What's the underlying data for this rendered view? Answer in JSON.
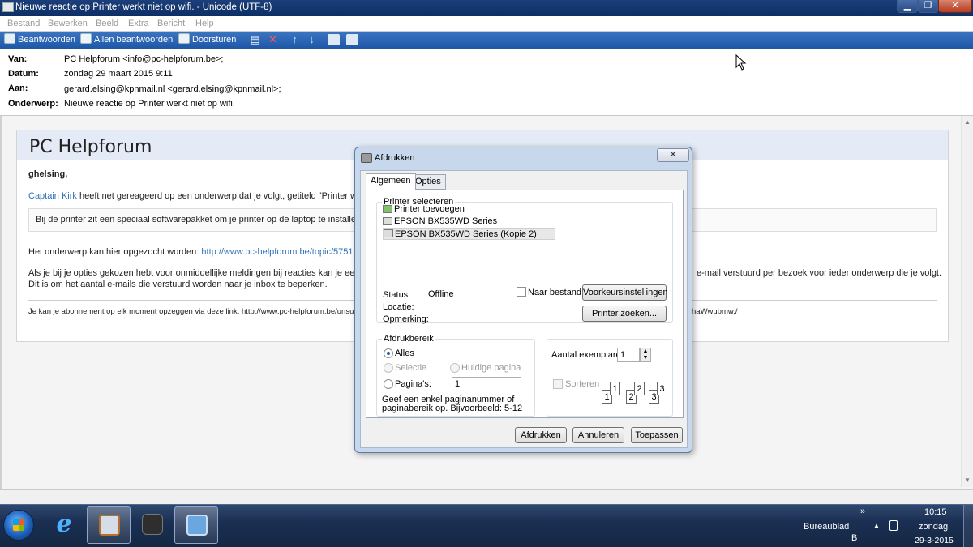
{
  "window": {
    "title": "Nieuwe reactie op Printer werkt niet op wifi. - Unicode (UTF-8)",
    "controls": {
      "minimize": "▁",
      "maximize": "❐",
      "close": "✕"
    }
  },
  "menu": [
    "Bestand",
    "Bewerken",
    "Beeld",
    "Extra",
    "Bericht",
    "Help"
  ],
  "toolbar": {
    "reply": "Beantwoorden",
    "reply_all": "Allen beantwoorden",
    "forward": "Doorsturen",
    "icons": [
      "print-icon",
      "delete-icon",
      "previous-icon",
      "next-icon",
      "addresses-icon",
      "contact-icon"
    ]
  },
  "headers": {
    "from_label": "Van:",
    "from": "PC Helpforum <info@pc-helpforum.be>;",
    "date_label": "Datum:",
    "date": "zondag 29 maart 2015 9:11",
    "to_label": "Aan:",
    "to": "gerard.elsing@kpnmail.nl <gerard.elsing@kpnmail.nl>;",
    "subject_label": "Onderwerp:",
    "subject": "Nieuwe reactie op Printer werkt niet op wifi."
  },
  "message": {
    "header_title": "PC Helpforum",
    "greeting": "ghelsing,",
    "author": "Captain Kirk",
    "line1": "heeft net gereageerd op een onderwerp dat je volgt, getiteld \"Printer werk",
    "quote": "Bij de printer zit een speciaal softwarepakket om je printer op de laptop te installere",
    "topic_text": "Het onderwerp kan hier opgezocht worden:",
    "topic_link": "http://www.pc-helpforum.be/topic/57513-p",
    "options_line1": "Als je bij je opties gekozen hebt voor onmiddellijke meldingen bij reacties kan je eeni",
    "options_line1_right": "e-mail verstuurd per bezoek voor ieder onderwerp die je volgt.",
    "options_line2": "Dit is om het aantal e-mails die verstuurd worden naar je inbox te beperken.",
    "unsubscribe": "Je kan je abonnement op elk moment opzeggen via deze link: http://www.pc-helpforum.be/unsu",
    "unsubscribe_right": "haWwubmw,/"
  },
  "dialog": {
    "title": "Afdrukken",
    "tabs": [
      "Algemeen",
      "Opties"
    ],
    "printer_group": "Printer selecteren",
    "printers": [
      "Printer toevoegen",
      "EPSON BX535WD Series",
      "EPSON BX535WD Series (Kopie 2)"
    ],
    "selected_printer_index": 2,
    "status_label": "Status:",
    "status_value": "Offline",
    "location_label": "Locatie:",
    "comment_label": "Opmerking:",
    "to_file_label": "Naar bestand",
    "preferences_button": "Voorkeursinstellingen",
    "find_printer_button": "Printer zoeken...",
    "range_group": "Afdrukbereik",
    "range_all": "Alles",
    "range_selection": "Selectie",
    "range_current": "Huidige pagina",
    "range_pages": "Pagina's:",
    "pages_value": "1",
    "range_hint": "Geef een enkel paginanummer of paginabereik op. Bijvoorbeeld: 5-12",
    "copies_label": "Aantal exemplaren:",
    "copies_value": "1",
    "collate_label": "Sorteren",
    "collate_pages": [
      "1",
      "1",
      "2",
      "2",
      "3",
      "3"
    ],
    "print_button": "Afdrukken",
    "cancel_button": "Annuleren",
    "apply_button": "Toepassen"
  },
  "taskbar": {
    "tray_expand": "»",
    "desktop": "Bureaublad",
    "desktop_sub": "B",
    "tray_arrow": "▲",
    "time": "10:15",
    "day": "zondag",
    "date": "29-3-2015"
  }
}
